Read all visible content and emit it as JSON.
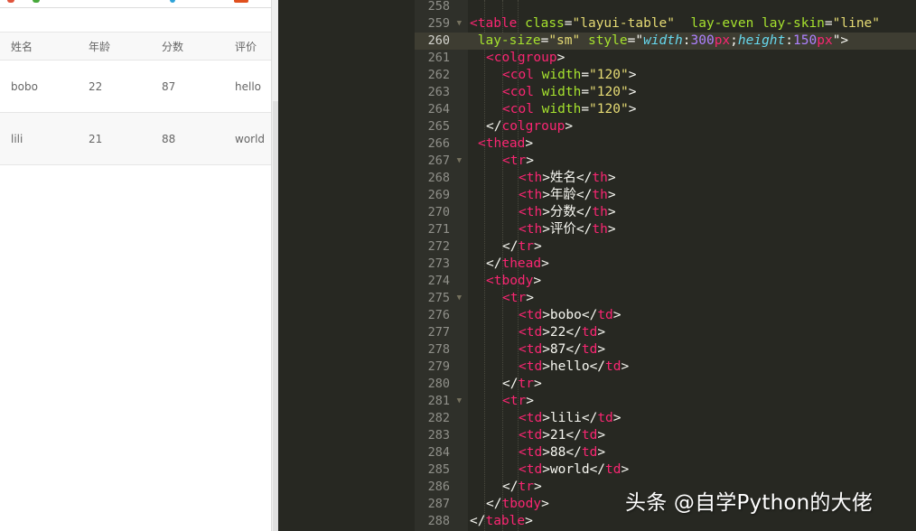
{
  "preview": {
    "headers": [
      "姓名",
      "年龄",
      "分数",
      "评价"
    ],
    "rows": [
      [
        "bobo",
        "22",
        "87",
        "hello"
      ],
      [
        "lili",
        "21",
        "88",
        "world"
      ]
    ]
  },
  "editor": {
    "active_line": 260,
    "lines": [
      {
        "n": 258,
        "fold": false,
        "indent": 0,
        "parts": []
      },
      {
        "n": 259,
        "fold": true,
        "indent": 0,
        "parts": [
          [
            "t",
            "<table"
          ],
          [
            "p",
            " "
          ],
          [
            "a",
            "class"
          ],
          [
            "p",
            "="
          ],
          [
            "s",
            "\"layui-table\""
          ],
          [
            "p",
            "  "
          ],
          [
            "a",
            "lay-even"
          ],
          [
            "p",
            " "
          ],
          [
            "a",
            "lay-skin"
          ],
          [
            "p",
            "="
          ],
          [
            "s",
            "\"line\""
          ]
        ]
      },
      {
        "n": 260,
        "fold": false,
        "indent": 0,
        "parts": [
          [
            "p",
            " "
          ],
          [
            "a",
            "lay-size"
          ],
          [
            "p",
            "="
          ],
          [
            "s",
            "\"sm\""
          ],
          [
            "p",
            " "
          ],
          [
            "a",
            "style"
          ],
          [
            "p",
            "=\""
          ],
          [
            "k",
            "width"
          ],
          [
            "p",
            ":"
          ],
          [
            "n",
            "300"
          ],
          [
            "t",
            "px"
          ],
          [
            "p",
            ";"
          ],
          [
            "k",
            "height"
          ],
          [
            "p",
            ":"
          ],
          [
            "n",
            "150"
          ],
          [
            "t",
            "px"
          ],
          [
            "p",
            "\">"
          ]
        ]
      },
      {
        "n": 261,
        "fold": false,
        "indent": 1,
        "parts": [
          [
            "t",
            "<colgroup"
          ],
          [
            "p",
            ">"
          ]
        ]
      },
      {
        "n": 262,
        "fold": false,
        "indent": 2,
        "parts": [
          [
            "t",
            "<col"
          ],
          [
            "p",
            " "
          ],
          [
            "a",
            "width"
          ],
          [
            "p",
            "="
          ],
          [
            "s",
            "\"120\""
          ],
          [
            "p",
            ">"
          ]
        ]
      },
      {
        "n": 263,
        "fold": false,
        "indent": 2,
        "parts": [
          [
            "t",
            "<col"
          ],
          [
            "p",
            " "
          ],
          [
            "a",
            "width"
          ],
          [
            "p",
            "="
          ],
          [
            "s",
            "\"120\""
          ],
          [
            "p",
            ">"
          ]
        ]
      },
      {
        "n": 264,
        "fold": false,
        "indent": 2,
        "parts": [
          [
            "t",
            "<col"
          ],
          [
            "p",
            " "
          ],
          [
            "a",
            "width"
          ],
          [
            "p",
            "="
          ],
          [
            "s",
            "\"120\""
          ],
          [
            "p",
            ">"
          ]
        ]
      },
      {
        "n": 265,
        "fold": false,
        "indent": 1,
        "parts": [
          [
            "p",
            "</"
          ],
          [
            "t",
            "colgroup"
          ],
          [
            "p",
            ">"
          ]
        ]
      },
      {
        "n": 266,
        "fold": false,
        "indent": 0.5,
        "parts": [
          [
            "t",
            "<thead"
          ],
          [
            "p",
            ">"
          ]
        ]
      },
      {
        "n": 267,
        "fold": true,
        "indent": 2,
        "parts": [
          [
            "t",
            "<tr"
          ],
          [
            "p",
            ">"
          ]
        ]
      },
      {
        "n": 268,
        "fold": false,
        "indent": 3,
        "parts": [
          [
            "t",
            "<th"
          ],
          [
            "p",
            ">姓名</"
          ],
          [
            "t",
            "th"
          ],
          [
            "p",
            ">"
          ]
        ]
      },
      {
        "n": 269,
        "fold": false,
        "indent": 3,
        "parts": [
          [
            "t",
            "<th"
          ],
          [
            "p",
            ">年龄</"
          ],
          [
            "t",
            "th"
          ],
          [
            "p",
            ">"
          ]
        ]
      },
      {
        "n": 270,
        "fold": false,
        "indent": 3,
        "parts": [
          [
            "t",
            "<th"
          ],
          [
            "p",
            ">分数</"
          ],
          [
            "t",
            "th"
          ],
          [
            "p",
            ">"
          ]
        ]
      },
      {
        "n": 271,
        "fold": false,
        "indent": 3,
        "parts": [
          [
            "t",
            "<th"
          ],
          [
            "p",
            ">评价</"
          ],
          [
            "t",
            "th"
          ],
          [
            "p",
            ">"
          ]
        ]
      },
      {
        "n": 272,
        "fold": false,
        "indent": 2,
        "parts": [
          [
            "p",
            "</"
          ],
          [
            "t",
            "tr"
          ],
          [
            "p",
            ">"
          ]
        ]
      },
      {
        "n": 273,
        "fold": false,
        "indent": 1,
        "parts": [
          [
            "p",
            "</"
          ],
          [
            "t",
            "thead"
          ],
          [
            "p",
            ">"
          ]
        ]
      },
      {
        "n": 274,
        "fold": false,
        "indent": 1,
        "parts": [
          [
            "t",
            "<tbody"
          ],
          [
            "p",
            ">"
          ]
        ]
      },
      {
        "n": 275,
        "fold": true,
        "indent": 2,
        "parts": [
          [
            "t",
            "<tr"
          ],
          [
            "p",
            ">"
          ]
        ]
      },
      {
        "n": 276,
        "fold": false,
        "indent": 3,
        "parts": [
          [
            "t",
            "<td"
          ],
          [
            "p",
            ">bobo</"
          ],
          [
            "t",
            "td"
          ],
          [
            "p",
            ">"
          ]
        ]
      },
      {
        "n": 277,
        "fold": false,
        "indent": 3,
        "parts": [
          [
            "t",
            "<td"
          ],
          [
            "p",
            ">22</"
          ],
          [
            "t",
            "td"
          ],
          [
            "p",
            ">"
          ]
        ]
      },
      {
        "n": 278,
        "fold": false,
        "indent": 3,
        "parts": [
          [
            "t",
            "<td"
          ],
          [
            "p",
            ">87</"
          ],
          [
            "t",
            "td"
          ],
          [
            "p",
            ">"
          ]
        ]
      },
      {
        "n": 279,
        "fold": false,
        "indent": 3,
        "parts": [
          [
            "t",
            "<td"
          ],
          [
            "p",
            ">hello</"
          ],
          [
            "t",
            "td"
          ],
          [
            "p",
            ">"
          ]
        ]
      },
      {
        "n": 280,
        "fold": false,
        "indent": 2,
        "parts": [
          [
            "p",
            "</"
          ],
          [
            "t",
            "tr"
          ],
          [
            "p",
            ">"
          ]
        ]
      },
      {
        "n": 281,
        "fold": true,
        "indent": 2,
        "parts": [
          [
            "t",
            "<tr"
          ],
          [
            "p",
            ">"
          ]
        ]
      },
      {
        "n": 282,
        "fold": false,
        "indent": 3,
        "parts": [
          [
            "t",
            "<td"
          ],
          [
            "p",
            ">lili</"
          ],
          [
            "t",
            "td"
          ],
          [
            "p",
            ">"
          ]
        ]
      },
      {
        "n": 283,
        "fold": false,
        "indent": 3,
        "parts": [
          [
            "t",
            "<td"
          ],
          [
            "p",
            ">21</"
          ],
          [
            "t",
            "td"
          ],
          [
            "p",
            ">"
          ]
        ]
      },
      {
        "n": 284,
        "fold": false,
        "indent": 3,
        "parts": [
          [
            "t",
            "<td"
          ],
          [
            "p",
            ">88</"
          ],
          [
            "t",
            "td"
          ],
          [
            "p",
            ">"
          ]
        ]
      },
      {
        "n": 285,
        "fold": false,
        "indent": 3,
        "parts": [
          [
            "t",
            "<td"
          ],
          [
            "p",
            ">world</"
          ],
          [
            "t",
            "td"
          ],
          [
            "p",
            ">"
          ]
        ]
      },
      {
        "n": 286,
        "fold": false,
        "indent": 2,
        "parts": [
          [
            "p",
            "</"
          ],
          [
            "t",
            "tr"
          ],
          [
            "p",
            ">"
          ]
        ]
      },
      {
        "n": 287,
        "fold": false,
        "indent": 1,
        "parts": [
          [
            "p",
            "</"
          ],
          [
            "t",
            "tbody"
          ],
          [
            "p",
            ">"
          ]
        ]
      },
      {
        "n": 288,
        "fold": false,
        "indent": 0,
        "parts": [
          [
            "p",
            "</"
          ],
          [
            "t",
            "table"
          ],
          [
            "p",
            ">"
          ]
        ]
      }
    ]
  },
  "watermark": "头条 @自学Python的大佬",
  "colors": {
    "editor_bg": "#272822",
    "tag": "#f92672",
    "attribute": "#a6e22e",
    "string": "#e6db74",
    "css_property": "#66d9ef",
    "number": "#ae81ff"
  }
}
